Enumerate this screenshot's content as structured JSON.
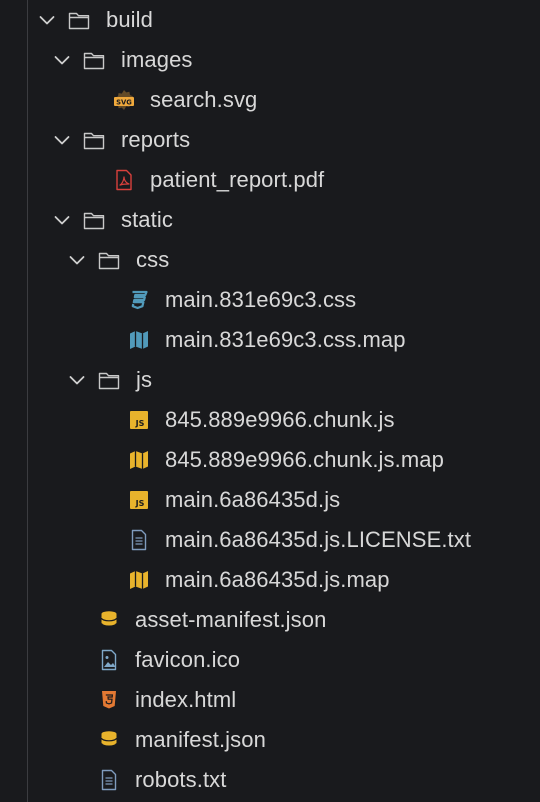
{
  "explorer": {
    "items": [
      {
        "label": "build",
        "kind": "folder",
        "depth": 0,
        "expanded": true
      },
      {
        "label": "images",
        "kind": "folder",
        "depth": 1,
        "expanded": true
      },
      {
        "label": "search.svg",
        "kind": "svg-file",
        "depth": 2
      },
      {
        "label": "reports",
        "kind": "folder",
        "depth": 1,
        "expanded": true
      },
      {
        "label": "patient_report.pdf",
        "kind": "pdf-file",
        "depth": 2
      },
      {
        "label": "static",
        "kind": "folder",
        "depth": 1,
        "expanded": true
      },
      {
        "label": "css",
        "kind": "folder",
        "depth": 2,
        "expanded": true
      },
      {
        "label": "main.831e69c3.css",
        "kind": "css-file",
        "depth": 3
      },
      {
        "label": "main.831e69c3.css.map",
        "kind": "map-file-blue",
        "depth": 3
      },
      {
        "label": "js",
        "kind": "folder",
        "depth": 2,
        "expanded": true
      },
      {
        "label": "845.889e9966.chunk.js",
        "kind": "js-file",
        "depth": 3
      },
      {
        "label": "845.889e9966.chunk.js.map",
        "kind": "map-file-yellow",
        "depth": 3
      },
      {
        "label": "main.6a86435d.js",
        "kind": "js-file",
        "depth": 3
      },
      {
        "label": "main.6a86435d.js.LICENSE.txt",
        "kind": "text-file",
        "depth": 3
      },
      {
        "label": "main.6a86435d.js.map",
        "kind": "map-file-yellow",
        "depth": 3
      },
      {
        "label": "asset-manifest.json",
        "kind": "json-file",
        "depth": 1
      },
      {
        "label": "favicon.ico",
        "kind": "image-file",
        "depth": 1
      },
      {
        "label": "index.html",
        "kind": "html-file",
        "depth": 1
      },
      {
        "label": "manifest.json",
        "kind": "json-file",
        "depth": 1
      },
      {
        "label": "robots.txt",
        "kind": "text-file",
        "depth": 1
      }
    ]
  },
  "colors": {
    "background": "#191a1d",
    "text": "#d8d8d8",
    "folder_stroke": "#c8c8c8",
    "guide": "#3b3c40",
    "svg_icon": "#f0a93c",
    "pdf_icon": "#d8403c",
    "css_icon": "#519aba",
    "js_icon": "#cbcb41",
    "json_icon": "#e8b32c",
    "html_icon": "#e37933",
    "text_icon": "#7f9bbd",
    "image_icon": "#7fa8c9"
  }
}
